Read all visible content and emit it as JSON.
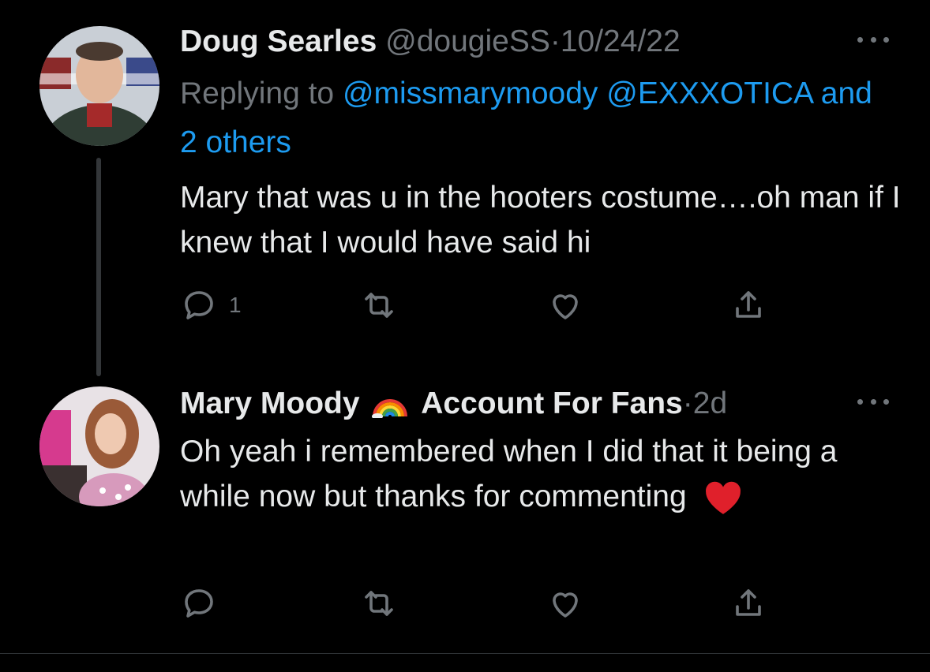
{
  "tweets": [
    {
      "author_name": "Doug Searles",
      "handle": "@dougieSS",
      "separator": "·",
      "time": "10/24/22",
      "replying_prefix": "Replying to",
      "mention_1": "@missmarymoody",
      "mention_2": "@EXXXOTICA",
      "mention_others": "and 2 others",
      "text": "Mary that was u in the hooters costume….oh man if I knew that I would have said hi",
      "reply_count": "1",
      "avatar_icon": "person-photo-avatar"
    },
    {
      "author_name_part1": "Mary Moody",
      "author_emoji": "rainbow-emoji",
      "author_name_part2": "Account For Fans",
      "separator": "·",
      "time": "2d",
      "text": "Oh yeah i remembered when I did that it being a while now but thanks for commenting",
      "text_emoji": "red-heart-emoji",
      "avatar_icon": "person-photo-avatar"
    }
  ],
  "colors": {
    "background": "#000000",
    "text_primary": "#e7e9ea",
    "text_secondary": "#71767b",
    "accent": "#1d9bf0"
  },
  "icons": [
    "reply-icon",
    "retweet-icon",
    "like-icon",
    "share-icon",
    "more-icon"
  ]
}
